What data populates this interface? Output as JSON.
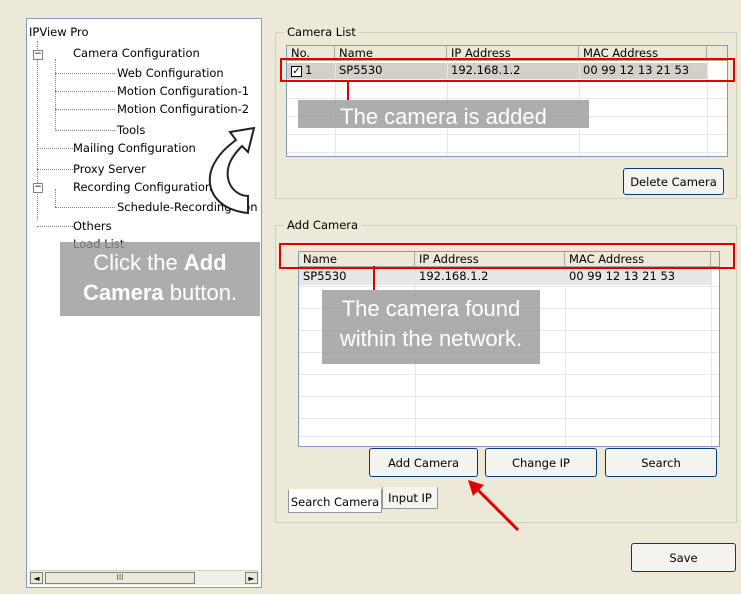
{
  "tree": {
    "root": "IPView Pro",
    "items": [
      {
        "label": "Camera Configuration",
        "expander": "−"
      },
      {
        "label": "Web Configuration"
      },
      {
        "label": "Motion Configuration-1"
      },
      {
        "label": "Motion Configuration-2"
      },
      {
        "label": "Tools"
      },
      {
        "label": "Mailing Configuration"
      },
      {
        "label": "Proxy Server"
      },
      {
        "label": "Recording Configuration",
        "expander": "−"
      },
      {
        "label": "Schedule-Recording Con"
      },
      {
        "label": "Others"
      },
      {
        "label": "Load List"
      }
    ],
    "scroll_left": "◄",
    "scroll_right": "►",
    "scroll_grip": "III"
  },
  "camera_list": {
    "title": "Camera List",
    "columns": [
      "No.",
      "Name",
      "IP Address",
      "MAC Address"
    ],
    "rows": [
      {
        "checked": "✓",
        "no": "1",
        "name": "SP5530",
        "ip": "192.168.1.2",
        "mac": "00 99 12 13 21 53"
      }
    ],
    "delete_button": "Delete Camera"
  },
  "add_camera": {
    "title": "Add Camera",
    "columns": [
      "Name",
      "IP Address",
      "MAC Address"
    ],
    "rows": [
      {
        "name": "SP5530",
        "ip": "192.168.1.2",
        "mac": "00 99 12 13 21 53"
      }
    ],
    "add_button": "Add Camera",
    "change_ip_button": "Change IP",
    "search_button": "Search",
    "tabs": [
      "Search Camera",
      "Input IP"
    ]
  },
  "save_button": "Save",
  "annotations": {
    "camera_added": "The camera is added",
    "click_add_pre": "Click the ",
    "click_add_bold": "Add",
    "click_add_line2_bold": "Camera",
    "click_add_line2_post": " button.",
    "camera_found_line1": "The camera found",
    "camera_found_line2": "within the network.",
    "highlight_color": "#e00000",
    "callout_color": "#969696"
  }
}
